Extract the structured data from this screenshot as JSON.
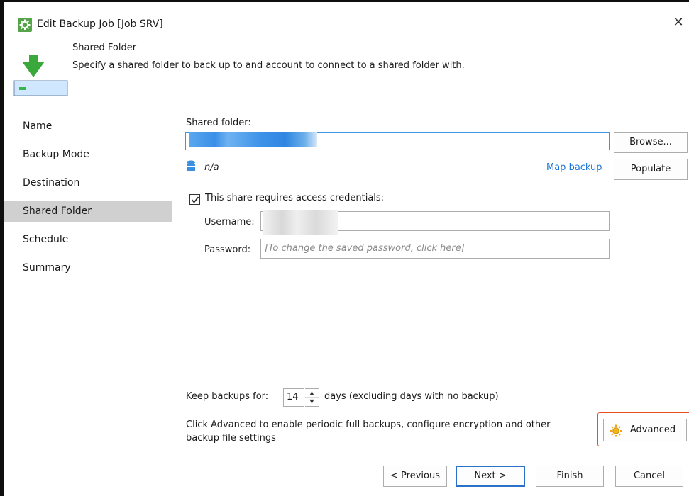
{
  "window": {
    "title": "Edit Backup Job [Job SRV]",
    "close_glyph": "✕"
  },
  "header": {
    "title": "Shared Folder",
    "description": "Specify a shared folder to back up to and account to connect to a shared folder with.",
    "icon": "download-arrow-icon"
  },
  "sidebar": {
    "items": [
      {
        "label": "Name"
      },
      {
        "label": "Backup Mode"
      },
      {
        "label": "Destination"
      },
      {
        "label": "Shared Folder",
        "active": true
      },
      {
        "label": "Schedule"
      },
      {
        "label": "Summary"
      }
    ]
  },
  "shared_folder": {
    "label": "Shared folder:",
    "value": "",
    "browse_label": "Browse...",
    "storage_info": "n/a",
    "map_backup_label": "Map backup",
    "populate_label": "Populate"
  },
  "credentials": {
    "checkbox_label": "This share requires access credentials:",
    "checked": true,
    "username_label": "Username:",
    "username_value": "",
    "password_label": "Password:",
    "password_placeholder": "[To change the saved password, click here]"
  },
  "retention": {
    "prefix": "Keep backups for:",
    "value": "14",
    "suffix": "days (excluding days with no backup)"
  },
  "advanced": {
    "hint": "Click Advanced to enable periodic full backups, configure encryption and other backup file settings",
    "button_label": "Advanced"
  },
  "footer": {
    "previous_label": "< Previous",
    "next_label": "Next >",
    "finish_label": "Finish",
    "cancel_label": "Cancel"
  },
  "colors": {
    "accent": "#3c96e2",
    "brand_green": "#55a44a",
    "highlight_border": "#e8501f",
    "active_nav_bg": "#cfd0cf",
    "link": "#1a73d8"
  }
}
